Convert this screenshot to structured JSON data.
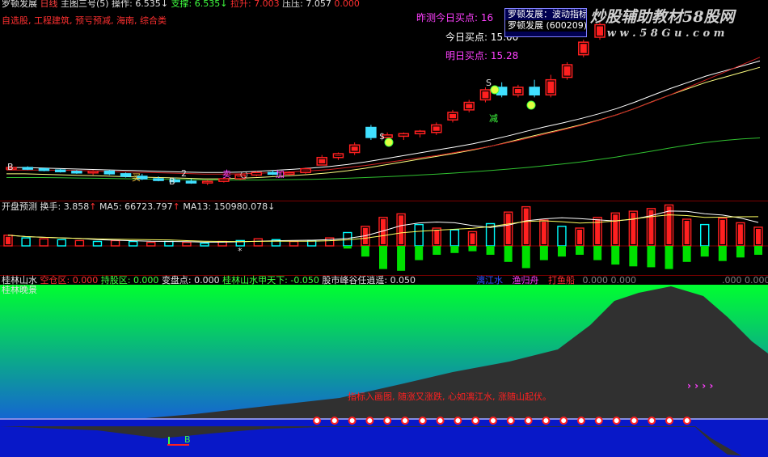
{
  "colors": {
    "bg": "#000000",
    "up": "#ff2020",
    "down": "#40e0ff",
    "ma_white": "#ffffff",
    "ma_red": "#d02020",
    "ma_yellow": "#ffff80",
    "ma_green": "#30c030",
    "vol_up": "#ff2020",
    "vol_down": "#00ffff",
    "hist_green": "#00e000",
    "panel_sep": "#7a0000",
    "magenta": "#ff40ff",
    "sky_top": "#00ff30",
    "sky_bottom": "#1a3aff",
    "mountain": "#303030",
    "water": "#0818c8"
  },
  "main": {
    "name": "罗顿发展",
    "period": "日线",
    "indicator": "主图三号(5)",
    "op_label": "操作:",
    "op_value": "6.535",
    "op_arrow": "↓",
    "support_label": "支撑:",
    "support_value": "6.535",
    "support_arrow": "↓",
    "pull_label": "拉升:",
    "pull_value": "7.003",
    "press_label": "压压:",
    "press_value": "7.057",
    "press_extra": "0.000",
    "sectors": "自选股, 工程建筑, 预亏预减, 海南, 综合类",
    "yesterday_label": "昨测今日买点:",
    "yesterday_value": "16",
    "today_label": "今日买点:",
    "today_value": "15.00",
    "tomorrow_label": "明日买点:",
    "tomorrow_value": "15.28",
    "tooltip_1": "罗顿发展：波动指标",
    "tooltip_2": "罗顿发展 (600209)",
    "watermark_1": "炒股辅助教材58股网",
    "watermark_2": "w w w . 5 8 G u . c o m",
    "marks": {
      "B1": "B",
      "B2": "B",
      "B3": "B",
      "buy": "买",
      "jia": "加",
      "jian": "减",
      "sell": "卖",
      "s1": "$",
      "s2": "S",
      "c1": "○",
      "n2": "2",
      "star": "*"
    }
  },
  "volume": {
    "title": "开盘预测",
    "turnover_label": "换手:",
    "turnover_value": "3.858",
    "turnover_arrow": "↑",
    "ma5_label": "MA5:",
    "ma5_value": "66723.797",
    "ma5_arrow": "↑",
    "ma13_label": "MA13:",
    "ma13_value": "150980.078",
    "ma13_arrow": "↓"
  },
  "bottom": {
    "title": "桂林山水",
    "empty_label": "空仓区:",
    "empty_value": "0.000",
    "hold_label": "持股区:",
    "hold_value": "0.000",
    "change_label": "变盘点:",
    "change_value": "0.000",
    "guilin_label": "桂林山水甲天下:",
    "guilin_value": "-0.050",
    "market_label": "股市峰谷任逍遥:",
    "market_value": "0.050",
    "tag_blue": "漓江水",
    "tag_magenta": "渔归舟",
    "tag_red": "打鱼船",
    "tail_1": "0.000",
    "tail_2": "0.000",
    "tail_3": ".000",
    "tail_4": "0.000",
    "subtitle": "桂林晚景",
    "poem": "指标入画图, 随涨又涨跌, 心如漓江水, 涨随山起伏。",
    "arrows": "› › › ›"
  },
  "chart_data": {
    "type": "candlestick",
    "price_candles": [
      {
        "o": 13.1,
        "h": 13.2,
        "l": 13.0,
        "c": 13.1
      },
      {
        "o": 13.1,
        "h": 13.15,
        "l": 13.0,
        "c": 13.05
      },
      {
        "o": 13.05,
        "h": 13.1,
        "l": 12.95,
        "c": 13.0
      },
      {
        "o": 13.0,
        "h": 13.05,
        "l": 12.9,
        "c": 12.95
      },
      {
        "o": 12.95,
        "h": 13.0,
        "l": 12.85,
        "c": 12.9
      },
      {
        "o": 12.9,
        "h": 13.0,
        "l": 12.8,
        "c": 12.95
      },
      {
        "o": 12.95,
        "h": 13.0,
        "l": 12.8,
        "c": 12.85
      },
      {
        "o": 12.85,
        "h": 12.9,
        "l": 12.7,
        "c": 12.75
      },
      {
        "o": 12.75,
        "h": 12.85,
        "l": 12.6,
        "c": 12.65
      },
      {
        "o": 12.65,
        "h": 12.75,
        "l": 12.55,
        "c": 12.6
      },
      {
        "o": 12.6,
        "h": 12.7,
        "l": 12.5,
        "c": 12.55
      },
      {
        "o": 12.55,
        "h": 12.65,
        "l": 12.45,
        "c": 12.5
      },
      {
        "o": 12.5,
        "h": 12.6,
        "l": 12.4,
        "c": 12.55
      },
      {
        "o": 12.55,
        "h": 12.7,
        "l": 12.5,
        "c": 12.65
      },
      {
        "o": 12.65,
        "h": 12.85,
        "l": 12.6,
        "c": 12.8
      },
      {
        "o": 12.8,
        "h": 12.95,
        "l": 12.75,
        "c": 12.9
      },
      {
        "o": 12.9,
        "h": 13.0,
        "l": 12.8,
        "c": 12.85
      },
      {
        "o": 12.85,
        "h": 12.95,
        "l": 12.8,
        "c": 12.9
      },
      {
        "o": 12.9,
        "h": 13.1,
        "l": 12.85,
        "c": 13.05
      },
      {
        "o": 13.2,
        "h": 13.6,
        "l": 13.2,
        "c": 13.5
      },
      {
        "o": 13.5,
        "h": 13.7,
        "l": 13.4,
        "c": 13.65
      },
      {
        "o": 13.7,
        "h": 14.1,
        "l": 13.6,
        "c": 14.0
      },
      {
        "o": 14.7,
        "h": 14.8,
        "l": 14.2,
        "c": 14.3
      },
      {
        "o": 14.3,
        "h": 14.5,
        "l": 14.1,
        "c": 14.4
      },
      {
        "o": 14.35,
        "h": 14.5,
        "l": 14.2,
        "c": 14.45
      },
      {
        "o": 14.45,
        "h": 14.6,
        "l": 14.3,
        "c": 14.55
      },
      {
        "o": 14.5,
        "h": 14.9,
        "l": 14.4,
        "c": 14.8
      },
      {
        "o": 15.0,
        "h": 15.4,
        "l": 14.9,
        "c": 15.3
      },
      {
        "o": 15.4,
        "h": 15.8,
        "l": 15.3,
        "c": 15.7
      },
      {
        "o": 15.8,
        "h": 16.3,
        "l": 15.7,
        "c": 16.2
      },
      {
        "o": 16.3,
        "h": 16.5,
        "l": 15.9,
        "c": 16.0
      },
      {
        "o": 16.0,
        "h": 16.4,
        "l": 15.9,
        "c": 16.3
      },
      {
        "o": 16.3,
        "h": 16.6,
        "l": 15.9,
        "c": 16.0
      },
      {
        "o": 16.0,
        "h": 16.8,
        "l": 15.9,
        "c": 16.6
      },
      {
        "o": 16.7,
        "h": 17.3,
        "l": 16.6,
        "c": 17.2
      },
      {
        "o": 17.6,
        "h": 18.2,
        "l": 17.5,
        "c": 18.1
      },
      {
        "o": 18.3,
        "h": 18.9,
        "l": 18.2,
        "c": 18.8
      }
    ],
    "ma_white": [
      13.1,
      13.1,
      13.08,
      13.06,
      13.04,
      13.02,
      13.0,
      12.98,
      12.96,
      12.94,
      12.92,
      12.9,
      12.9,
      12.92,
      12.95,
      12.99,
      13.03,
      13.08,
      13.14,
      13.22,
      13.32,
      13.44,
      13.56,
      13.68,
      13.8,
      13.92,
      14.05,
      14.2,
      14.37,
      14.55,
      14.72,
      14.88,
      15.05,
      15.24,
      15.45,
      15.7,
      15.98,
      16.25,
      16.5,
      16.75,
      16.95,
      17.15,
      17.35
    ],
    "ma_red": [
      13.0,
      13.0,
      13.0,
      12.99,
      12.98,
      12.96,
      12.94,
      12.92,
      12.9,
      12.88,
      12.86,
      12.84,
      12.84,
      12.85,
      12.87,
      12.9,
      12.93,
      12.97,
      13.02,
      13.1,
      13.18,
      13.28,
      13.38,
      13.48,
      13.58,
      13.7,
      13.82,
      13.95,
      14.1,
      14.26,
      14.43,
      14.6,
      14.78,
      14.98,
      15.2,
      15.45,
      15.72,
      16.0,
      16.3,
      16.6,
      16.9,
      17.2,
      17.5
    ],
    "ma_green": [
      12.7,
      12.7,
      12.7,
      12.69,
      12.68,
      12.67,
      12.66,
      12.65,
      12.64,
      12.63,
      12.62,
      12.61,
      12.6,
      12.6,
      12.6,
      12.61,
      12.62,
      12.63,
      12.65,
      12.67,
      12.7,
      12.73,
      12.76,
      12.8,
      12.84,
      12.88,
      12.93,
      12.98,
      13.04,
      13.1,
      13.17,
      13.24,
      13.32,
      13.42,
      13.52,
      13.64,
      13.76,
      13.88,
      14.0,
      14.1,
      14.18,
      14.24,
      14.28
    ],
    "volume": [
      1.2,
      0.9,
      0.8,
      0.7,
      0.6,
      0.5,
      0.6,
      0.5,
      0.4,
      0.5,
      0.4,
      0.3,
      0.5,
      0.6,
      0.8,
      0.7,
      0.5,
      0.6,
      0.9,
      1.5,
      2.2,
      3.2,
      3.6,
      2.4,
      2.0,
      1.8,
      1.6,
      2.5,
      3.8,
      4.4,
      2.9,
      2.2,
      2.0,
      3.2,
      3.7,
      3.9,
      4.2,
      4.6,
      3.0,
      2.4,
      3.1,
      2.6,
      2.1
    ],
    "histogram": [
      0,
      0,
      0,
      0,
      0,
      0,
      0,
      0,
      0,
      0,
      0,
      0,
      0,
      0,
      0,
      0,
      0,
      0,
      0,
      -0.3,
      -1.2,
      -2.6,
      -2.8,
      -1.6,
      -1.0,
      -0.8,
      -0.6,
      -1.0,
      -1.8,
      -2.5,
      -1.6,
      -1.2,
      -1.0,
      -1.6,
      -2.1,
      -2.3,
      -2.4,
      -2.6,
      -1.8,
      -1.2,
      -1.7,
      -1.3,
      -1.0
    ]
  }
}
